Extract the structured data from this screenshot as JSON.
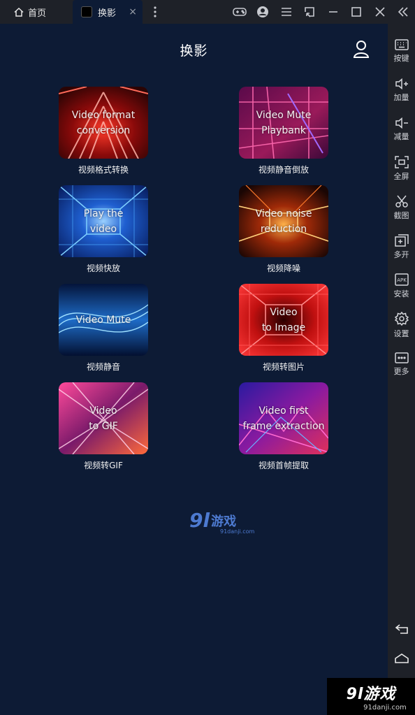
{
  "tabs": {
    "home_label": "首页",
    "app_label": "换影",
    "close_glyph": "×"
  },
  "app": {
    "title": "换影",
    "cards": [
      {
        "thumb_text": "Video format\nconversion",
        "label": "视频格式转换"
      },
      {
        "thumb_text": "Video Mute\nPlaybank",
        "label": "视频静音倒放"
      },
      {
        "thumb_text": "Play the\nvideo",
        "label": "视频快放"
      },
      {
        "thumb_text": "Video noise\nreduction",
        "label": "视频降噪"
      },
      {
        "thumb_text": "Video Mute",
        "label": "视频静音"
      },
      {
        "thumb_text": "Video\nto Image",
        "label": "视频转图片"
      },
      {
        "thumb_text": "Video\nto GIF",
        "label": "视频转GIF"
      },
      {
        "thumb_text": "Video first\nframe extraction",
        "label": "视频首帧提取"
      }
    ]
  },
  "sidebar": {
    "items": [
      {
        "label": "按键",
        "icon": "keyboard-icon"
      },
      {
        "label": "加量",
        "icon": "volume-up-icon"
      },
      {
        "label": "减量",
        "icon": "volume-down-icon"
      },
      {
        "label": "全屏",
        "icon": "fullscreen-icon"
      },
      {
        "label": "截图",
        "icon": "scissors-icon"
      },
      {
        "label": "多开",
        "icon": "multi-instance-icon"
      },
      {
        "label": "安装",
        "icon": "apk-icon"
      },
      {
        "label": "设置",
        "icon": "gear-icon"
      },
      {
        "label": "更多",
        "icon": "more-icon"
      }
    ]
  },
  "watermark": {
    "center_num": "9l",
    "center_text": "游戏",
    "center_sub": "91danji.com",
    "corner_big": "9l游戏",
    "corner_small": "91danji.com"
  },
  "colors": {
    "background": "#0d1b35",
    "chrome": "#1e2128",
    "text": "#ffffff",
    "watermark": "#4d7ad0"
  }
}
